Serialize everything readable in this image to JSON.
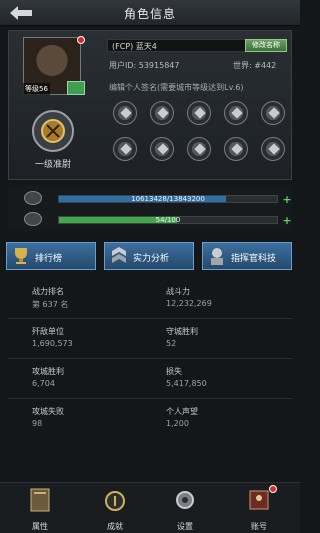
{
  "header": {
    "title": "角色信息"
  },
  "profile": {
    "level_label": "等级56",
    "rank_name": "一级准尉",
    "player_name": "(FCP) 蓝天4",
    "rename_label": "修改名称",
    "user_id": "用户ID: 53915847",
    "world": "世界: #442",
    "signature": "编辑个人签名(需要城市等级达到Lv.6)"
  },
  "medals": [
    "medal-icon",
    "medal-icon",
    "medal-icon",
    "medal-icon",
    "medal-icon",
    "medal-icon",
    "medal-icon",
    "medal-icon",
    "medal-icon",
    "lock-icon"
  ],
  "bars": {
    "exp": {
      "text": "10613428/13843200",
      "fill_fraction": 0.767
    },
    "power": {
      "text": "54/100",
      "fill_fraction": 0.54
    }
  },
  "tabs": [
    {
      "label": "排行榜"
    },
    {
      "label": "实力分析"
    },
    {
      "label": "指挥官科技"
    }
  ],
  "stats": [
    {
      "k": "战力排名",
      "v": "第 637 名"
    },
    {
      "k": "战斗力",
      "v": "12,232,269"
    },
    {
      "k": "歼敌单位",
      "v": "1,690,573"
    },
    {
      "k": "守城胜利",
      "v": "52"
    },
    {
      "k": "攻城胜利",
      "v": "6,704"
    },
    {
      "k": "损失",
      "v": "5,417,850"
    },
    {
      "k": "攻城失败",
      "v": "98"
    },
    {
      "k": "个人声望",
      "v": "1,200"
    }
  ],
  "bottom_nav": [
    {
      "label": "属性"
    },
    {
      "label": "成就"
    },
    {
      "label": "设置"
    },
    {
      "label": "账号"
    }
  ],
  "colors": {
    "accent_blue": "#3c6f9f",
    "green": "#4cb84f",
    "bg": "#14171a"
  }
}
